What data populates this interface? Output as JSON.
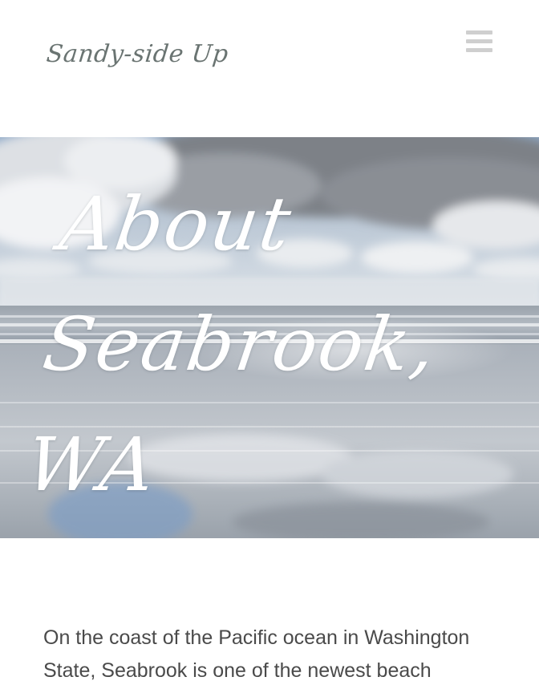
{
  "header": {
    "logo_text": "Sandy-side Up",
    "menu_icon": "hamburger-menu-icon"
  },
  "hero": {
    "title_lines": [
      "About",
      "Seabrook,",
      "WA"
    ],
    "image_description_icon": "beach-photo"
  },
  "content": {
    "intro_text": "On the coast of the Pacific ocean in Washington State, Seabrook is one of the newest beach"
  },
  "colors": {
    "background": "#ffffff",
    "logo": "#6a7472",
    "menu_icon": "#cfcfcf",
    "hero_title": "#ffffff",
    "body_text": "#4a4a4a"
  }
}
